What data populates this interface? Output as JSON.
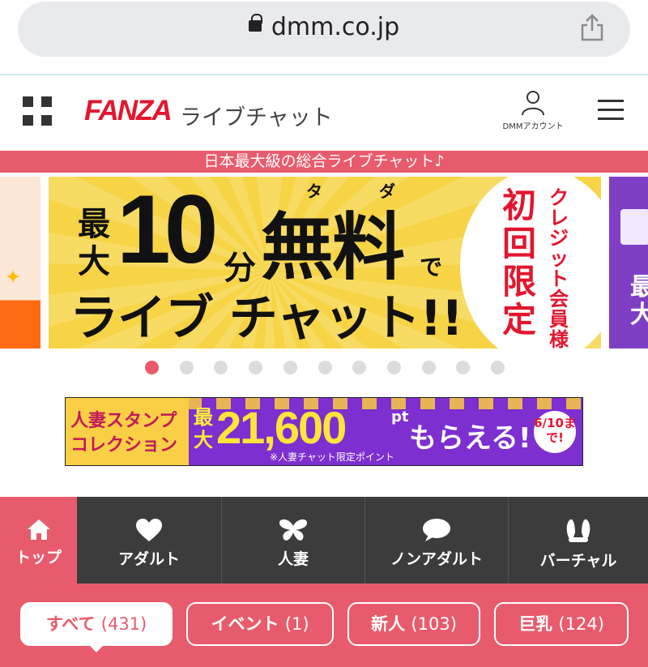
{
  "browser": {
    "url": "dmm.co.jp"
  },
  "header": {
    "logo": "FANZA",
    "logo_sub": "ライブチャット",
    "account_label": "DMMアカウント"
  },
  "tagline": "日本最大級の総合ライブチャット♪",
  "banner": {
    "prefix": "最大",
    "number": "10",
    "unit": "分",
    "free": "無料",
    "ruby": [
      "タ",
      "ダ"
    ],
    "de": "で",
    "title": "ライブ チャット!!",
    "badge_main": "初回限定",
    "badge_side": "クレジット会員様"
  },
  "carousel": {
    "total_slides": 11,
    "active_index": 0
  },
  "sub_banner": {
    "left_text": "人妻スタンプコレクション",
    "prefix": "最大",
    "amount": "21,600",
    "unit": "pt",
    "cta": "もらえる!",
    "note": "※人妻チャット限定ポイント",
    "date": "6/10まで!"
  },
  "categories": [
    {
      "label": "トップ",
      "icon": "home-icon"
    },
    {
      "label": "アダルト",
      "icon": "heart-icon"
    },
    {
      "label": "人妻",
      "icon": "butterfly-icon"
    },
    {
      "label": "ノンアダルト",
      "icon": "speech-bubble-icon"
    },
    {
      "label": "バーチャル",
      "icon": "bunny-ears-icon"
    }
  ],
  "filters": [
    {
      "label": "すべて",
      "count": "(431)"
    },
    {
      "label": "イベント",
      "count": "(1)"
    },
    {
      "label": "新人",
      "count": "(103)"
    },
    {
      "label": "巨乳",
      "count": "(124)"
    }
  ],
  "colors": {
    "brand_red": "#e3162e",
    "accent_pink": "#e85b6c",
    "nav_dark": "#3c3c3c",
    "banner_yellow": "#f6d445",
    "banner_purple": "#7d2fd0"
  }
}
